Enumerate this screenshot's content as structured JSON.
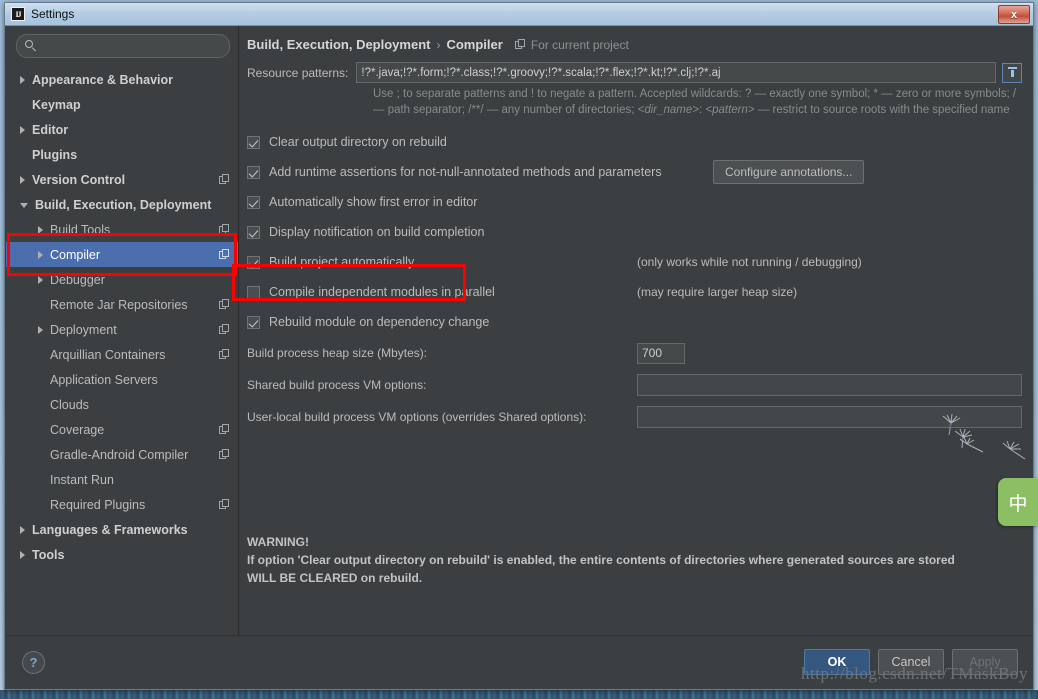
{
  "window": {
    "title": "Settings",
    "logo_text": "IJ",
    "close_label": "x"
  },
  "search": {
    "value": "",
    "placeholder": "",
    "icon": "search-icon"
  },
  "sidebar": {
    "items": [
      {
        "label": "Appearance & Behavior",
        "level": 0,
        "arrow": "right",
        "bold": true,
        "badge": false,
        "selected": false
      },
      {
        "label": "Keymap",
        "level": 0,
        "arrow": "none",
        "bold": true,
        "badge": false,
        "selected": false
      },
      {
        "label": "Editor",
        "level": 0,
        "arrow": "right",
        "bold": true,
        "badge": false,
        "selected": false
      },
      {
        "label": "Plugins",
        "level": 0,
        "arrow": "none",
        "bold": true,
        "badge": false,
        "selected": false
      },
      {
        "label": "Version Control",
        "level": 0,
        "arrow": "right",
        "bold": true,
        "badge": true,
        "selected": false
      },
      {
        "label": "Build, Execution, Deployment",
        "level": 0,
        "arrow": "down",
        "bold": true,
        "badge": false,
        "selected": false
      },
      {
        "label": "Build Tools",
        "level": 1,
        "arrow": "right",
        "bold": false,
        "badge": true,
        "selected": false
      },
      {
        "label": "Compiler",
        "level": 1,
        "arrow": "right",
        "bold": false,
        "badge": true,
        "selected": true
      },
      {
        "label": "Debugger",
        "level": 1,
        "arrow": "right",
        "bold": false,
        "badge": false,
        "selected": false
      },
      {
        "label": "Remote Jar Repositories",
        "level": 1,
        "arrow": "none",
        "bold": false,
        "badge": true,
        "selected": false
      },
      {
        "label": "Deployment",
        "level": 1,
        "arrow": "right",
        "bold": false,
        "badge": true,
        "selected": false
      },
      {
        "label": "Arquillian Containers",
        "level": 1,
        "arrow": "none",
        "bold": false,
        "badge": true,
        "selected": false
      },
      {
        "label": "Application Servers",
        "level": 1,
        "arrow": "none",
        "bold": false,
        "badge": false,
        "selected": false
      },
      {
        "label": "Clouds",
        "level": 1,
        "arrow": "none",
        "bold": false,
        "badge": false,
        "selected": false
      },
      {
        "label": "Coverage",
        "level": 1,
        "arrow": "none",
        "bold": false,
        "badge": true,
        "selected": false
      },
      {
        "label": "Gradle-Android Compiler",
        "level": 1,
        "arrow": "none",
        "bold": false,
        "badge": true,
        "selected": false
      },
      {
        "label": "Instant Run",
        "level": 1,
        "arrow": "none",
        "bold": false,
        "badge": false,
        "selected": false
      },
      {
        "label": "Required Plugins",
        "level": 1,
        "arrow": "none",
        "bold": false,
        "badge": true,
        "selected": false
      },
      {
        "label": "Languages & Frameworks",
        "level": 0,
        "arrow": "right",
        "bold": true,
        "badge": false,
        "selected": false
      },
      {
        "label": "Tools",
        "level": 0,
        "arrow": "right",
        "bold": true,
        "badge": false,
        "selected": false
      }
    ]
  },
  "breadcrumb": {
    "parent": "Build, Execution, Deployment",
    "separator": "›",
    "current": "Compiler",
    "scope_label": "For current project"
  },
  "compiler": {
    "resource_patterns_label": "Resource patterns:",
    "resource_patterns_value": "!?*.java;!?*.form;!?*.class;!?*.groovy;!?*.scala;!?*.flex;!?*.kt;!?*.clj;!?*.aj",
    "resource_patterns_hint_1": "Use ; to separate patterns and ! to negate a pattern. Accepted wildcards: ? — exactly one symbol; * — zero or more symbols; / — path separator; /**/ — any number of directories; ",
    "resource_patterns_hint_dir": "<dir_name>",
    "resource_patterns_hint_colon": ": ",
    "resource_patterns_hint_pattern": "<pattern>",
    "resource_patterns_hint_2": " — restrict to source roots with the specified name",
    "checkboxes": [
      {
        "label": "Clear output directory on rebuild",
        "checked": true,
        "note": ""
      },
      {
        "label": "Add runtime assertions for not-null-annotated methods and parameters",
        "checked": true,
        "note": ""
      },
      {
        "label": "Automatically show first error in editor",
        "checked": true,
        "note": ""
      },
      {
        "label": "Display notification on build completion",
        "checked": true,
        "note": ""
      },
      {
        "label": "Build project automatically",
        "checked": true,
        "note": "(only works while not running / debugging)"
      },
      {
        "label": "Compile independent modules in parallel",
        "checked": false,
        "note": "(may require larger heap size)"
      },
      {
        "label": "Rebuild module on dependency change",
        "checked": true,
        "note": ""
      }
    ],
    "configure_annotations_label": "Configure annotations...",
    "heap_label": "Build process heap size (Mbytes):",
    "heap_value": "700",
    "shared_vm_label": "Shared build process VM options:",
    "shared_vm_value": "",
    "userlocal_vm_label": "User-local build process VM options (overrides Shared options):",
    "userlocal_vm_value": "",
    "warning_title": "WARNING!",
    "warning_line_1": "If option 'Clear output directory on rebuild' is enabled, the entire contents of directories where generated sources are stored",
    "warning_line_2": "WILL BE CLEARED on rebuild."
  },
  "buttons": {
    "help_label": "?",
    "ok_label": "OK",
    "cancel_label": "Cancel",
    "apply_label": "Apply"
  },
  "overlays": {
    "watermark": "http://blog.csdn.net/TMaskBoy",
    "ime_label": "中"
  },
  "colors": {
    "accent_selected": "#4b6eaf",
    "primary_button": "#365880",
    "annotation_red": "#ff0000",
    "ime_green": "#8cbf64",
    "panel_bg": "#3c3f41",
    "input_bg": "#45494a"
  }
}
